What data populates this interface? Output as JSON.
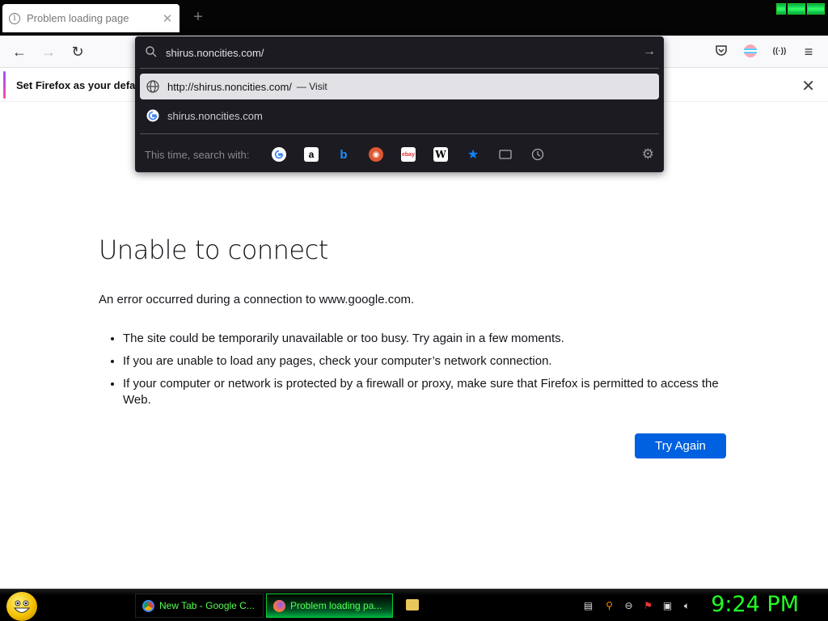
{
  "tab": {
    "title": "Problem loading page",
    "close": "✕",
    "new_tab": "+"
  },
  "nav": {
    "back": "←",
    "forward": "→",
    "reload": "↻"
  },
  "toolbar_icons": {
    "pocket": "pocket-icon",
    "account": "account-icon",
    "extensions": "extensions-icon",
    "menu": "≡"
  },
  "notification": {
    "message": "Set Firefox as your default",
    "close": "✕"
  },
  "urlbar": {
    "value": "shirus.noncities.com/",
    "results": [
      {
        "text": "http://shirus.noncities.com/",
        "action": "— Visit"
      },
      {
        "text": "shirus.noncities.com"
      }
    ],
    "search_with_label": "This time, search with:",
    "engines": [
      "google",
      "amazon",
      "bing",
      "duckduckgo",
      "ebay",
      "wikipedia",
      "bookmarks",
      "tabs",
      "history"
    ]
  },
  "error": {
    "title": "Unable to connect",
    "description": "An error occurred during a connection to www.google.com.",
    "items": [
      "The site could be temporarily unavailable or too busy. Try again in a few moments.",
      "If you are unable to load any pages, check your computer’s network connection.",
      "If your computer or network is protected by a firewall or proxy, make sure that Firefox is permitted to access the Web."
    ],
    "button": "Try Again"
  },
  "taskbar": {
    "tasks": [
      {
        "label": "New Tab - Google C..."
      },
      {
        "label": "Problem loading pa..."
      }
    ],
    "clock": "9:24 PM"
  },
  "colors": {
    "accent": "#0061e0",
    "popup_bg": "#1c1b22",
    "clock": "#22ff22"
  }
}
